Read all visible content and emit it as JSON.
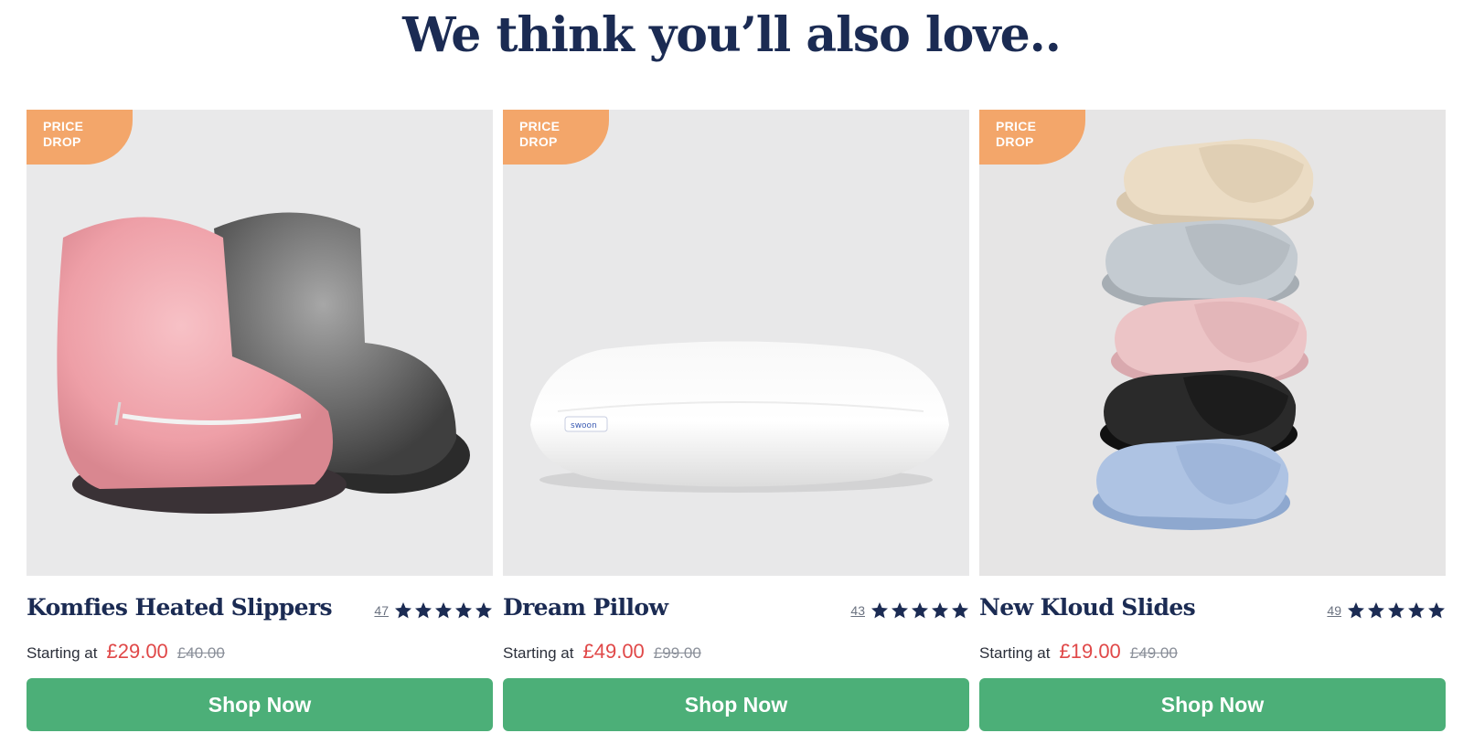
{
  "section": {
    "title": "We think you’ll also love.."
  },
  "products": [
    {
      "badge_line1": "PRICE",
      "badge_line2": "DROP",
      "name": "Komfies Heated Slippers",
      "review_count": "47",
      "rating": 5,
      "starting_label": "Starting at",
      "price": "£29.00",
      "was_price": "£40.00",
      "button_label": "Shop Now",
      "image": "pink-and-grey-fluffy-boot-slippers"
    },
    {
      "badge_line1": "PRICE",
      "badge_line2": "DROP",
      "name": "Dream Pillow",
      "review_count": "43",
      "rating": 5,
      "starting_label": "Starting at",
      "price": "£49.00",
      "was_price": "£99.00",
      "button_label": "Shop Now",
      "image": "white-pillow",
      "pillow_tag": "swoon"
    },
    {
      "badge_line1": "PRICE",
      "badge_line2": "DROP",
      "name": "New Kloud Slides",
      "review_count": "49",
      "rating": 5,
      "starting_label": "Starting at",
      "price": "£19.00",
      "was_price": "£49.00",
      "button_label": "Shop Now",
      "image": "stacked-slide-sandals"
    }
  ],
  "colors": {
    "title": "#1b2b53",
    "badge": "#f3a66a",
    "price": "#e04848",
    "button": "#4caf78",
    "star": "#1b2b53"
  },
  "icons": {
    "star": "star-icon"
  }
}
